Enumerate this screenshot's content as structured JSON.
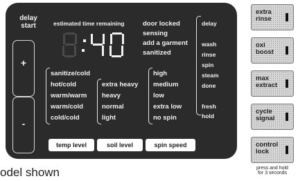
{
  "delay_start": {
    "line1": "delay",
    "line2": "start"
  },
  "side_buttons": {
    "plus": "+",
    "minus": "-"
  },
  "display": {
    "header": "estimated time remaining",
    "time": "40",
    "colon": ":"
  },
  "status_lights": [
    "door locked",
    "sensing",
    "add a garment",
    "sanitized"
  ],
  "cycle_status": {
    "delay": "delay",
    "wash": "wash",
    "rinse": "rinse",
    "spin": "spin",
    "steam": "steam",
    "done": "done",
    "fresh": "fresh",
    "hold": "hold"
  },
  "temp_levels": [
    "sanitize/cold",
    "hot/cold",
    "warm/warm",
    "warm/cold",
    "cold/cold"
  ],
  "soil_levels": [
    "extra heavy",
    "heavy",
    "normal",
    "light"
  ],
  "spin_speeds": [
    "high",
    "medium",
    "low",
    "extra low",
    "no spin"
  ],
  "bottom_buttons": {
    "temp": "temp level",
    "soil": "soil level",
    "spin": "spin speed"
  },
  "option_buttons": [
    {
      "line1": "extra",
      "line2": "rinse"
    },
    {
      "line1": "oxi",
      "line2": "boost"
    },
    {
      "line1": "max",
      "line2": "extract"
    },
    {
      "line1": "cycle",
      "line2": "signal"
    },
    {
      "line1": "control",
      "line2": "lock"
    }
  ],
  "control_lock_note": {
    "line1": "press and hold",
    "line2": "for 3 seconds"
  },
  "caption": "odel shown"
}
